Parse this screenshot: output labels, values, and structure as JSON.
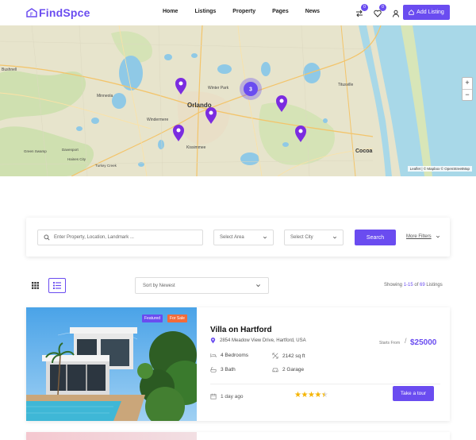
{
  "brand": {
    "name": "FindSpce",
    "accent": "#6a4cf0"
  },
  "nav": {
    "items": [
      "Home",
      "Listings",
      "Property",
      "Pages",
      "News"
    ]
  },
  "header_actions": {
    "compare_count": "0",
    "wishlist_count": "0",
    "add_listing": "Add Listing"
  },
  "map": {
    "cluster_count": "3",
    "zoom_in": "+",
    "zoom_out": "−",
    "attribution": "Leaflet | © Mapbox © OpenStreetMap",
    "labels": [
      "Orlando",
      "Bushnell",
      "Minneola",
      "Windermere",
      "Winter Park",
      "Titusville",
      "Cocoa",
      "Haines City",
      "Kissimmee",
      "Turkey Creek",
      "Green Swamp",
      "Davenport"
    ]
  },
  "search": {
    "placeholder": "Enter Property, Location, Landmark ...",
    "area_placeholder": "Select Area",
    "city_placeholder": "Select City",
    "button": "Search",
    "more_filters": "More Filters"
  },
  "toolbar": {
    "sort_label": "Sort by Newest",
    "showing_prefix": "Showing ",
    "range": "1-15",
    "of": " of ",
    "total": "69",
    "suffix": " Listings"
  },
  "listing": {
    "tags": [
      "Featured",
      "For Sale"
    ],
    "title": "Villa on Hartford",
    "address": "2854 Meadow View Drive, Hartford, USA",
    "price_label": "Starts From",
    "price": "$25000",
    "bedrooms": "4 Bedrooms",
    "area": "2142 sq ft",
    "bath": "3 Bath",
    "garage": "2 Garage",
    "posted": "1 day ago",
    "rating": 4.5,
    "tour_button": "Take a tour"
  }
}
